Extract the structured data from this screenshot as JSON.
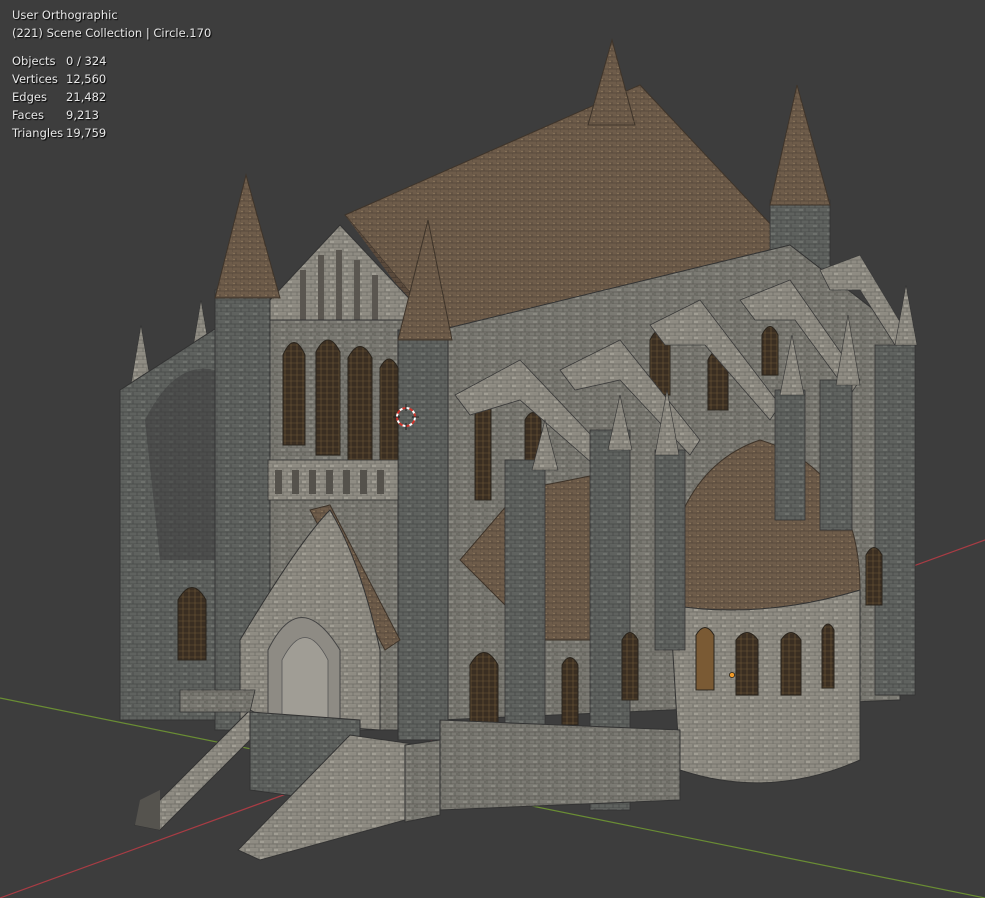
{
  "viewport": {
    "view_name": "User Orthographic",
    "collection_line": "(221) Scene Collection | Circle.170",
    "background_color": "#3d3d3d",
    "x_axis_color": "#a83c44",
    "y_axis_color": "#6a8d34"
  },
  "stats": [
    {
      "label": "Objects",
      "value": "0 / 324"
    },
    {
      "label": "Vertices",
      "value": "12,560"
    },
    {
      "label": "Edges",
      "value": "21,482"
    },
    {
      "label": "Faces",
      "value": "9,213"
    },
    {
      "label": "Triangles",
      "value": "19,759"
    }
  ],
  "scene": {
    "object_description": "gothic cathedral model",
    "3d_cursor": "3d-cursor-icon",
    "origin_marker": "object-origin-icon"
  }
}
